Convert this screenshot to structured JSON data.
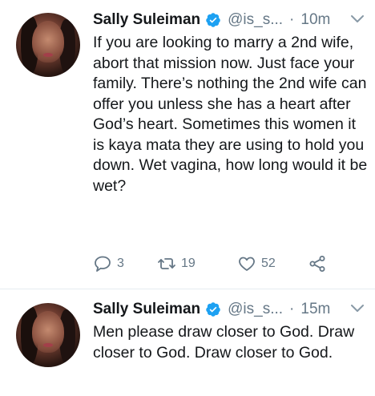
{
  "tweets": [
    {
      "author": "Sally Suleiman",
      "handle": "@is_s...",
      "separator": "·",
      "time": "10m",
      "text": "If you are looking to marry a 2nd wife, abort that mission now. Just face your family. There’s nothing the 2nd wife can offer you unless she has a heart after God’s heart. Sometimes this women it is kaya mata they are using to hold you down. Wet vagina, how long would it be wet?",
      "replies": "3",
      "retweets": "19",
      "likes": "52"
    },
    {
      "author": "Sally Suleiman",
      "handle": "@is_s...",
      "separator": "·",
      "time": "15m",
      "text": "Men please draw closer to God. Draw closer to God. Draw closer to God."
    }
  ],
  "icons": {
    "verified": "verified-badge-icon",
    "menu": "chevron-down-icon",
    "reply": "reply-icon",
    "retweet": "retweet-icon",
    "like": "heart-icon",
    "share": "share-icon"
  },
  "colors": {
    "verified": "#1da1f2",
    "text": "#14171a",
    "secondary": "#657786",
    "divider": "#e6ecf0"
  }
}
